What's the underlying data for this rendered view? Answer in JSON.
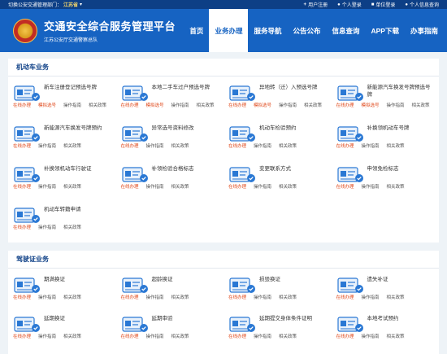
{
  "topbar": {
    "dept_label": "切换公安交通管理部门：",
    "dept_name": "江苏省",
    "register": "用户注册",
    "personal_login": "个人登录",
    "unit_login": "单位登录",
    "info_query": "个人信息查询"
  },
  "header": {
    "title": "交通安全综合服务管理平台",
    "subtitle": "江苏公安厅交通警察总队"
  },
  "nav": [
    "首页",
    "业务办理",
    "服务导航",
    "公告公布",
    "信息查询",
    "APP下载",
    "办事指南"
  ],
  "labels": {
    "online": "在线办理",
    "guide": "操作指南",
    "policy": "相关政策",
    "mock": "模拟选号"
  },
  "vehicle": {
    "title": "机动车业务",
    "items": [
      {
        "name": "新车注册登记预选号牌",
        "icon": "id-card-icon",
        "mock": true
      },
      {
        "name": "本地二手车过户预选号牌",
        "icon": "people-car-icon",
        "mock": true
      },
      {
        "name": "异地转（迁）入预选号牌",
        "icon": "transfer-car-icon",
        "mock": true
      },
      {
        "name": "新能源汽车换发号牌预选号牌",
        "icon": "ev-car-icon",
        "mock": true
      },
      {
        "name": "新能源汽车换发号牌预约",
        "icon": "ev-plate-icon",
        "mock": false
      },
      {
        "name": "异常选号资料修改",
        "icon": "plate-123-icon",
        "mock": false
      },
      {
        "name": "机动车检验预约",
        "icon": "inspection-icon",
        "mock": false
      },
      {
        "name": "补换领机动车号牌",
        "icon": "plate-replace-icon",
        "mock": false
      },
      {
        "name": "补换领机动车行驶证",
        "icon": "license-replace-icon",
        "mock": false
      },
      {
        "name": "补领检验合格标志",
        "icon": "inspection-badge-icon",
        "mock": false
      },
      {
        "name": "变更联系方式",
        "icon": "contact-card-icon",
        "mock": false
      },
      {
        "name": "申领免检标志",
        "icon": "exempt-badge-icon",
        "mock": false
      },
      {
        "name": "机动车转籍申请",
        "icon": "transfer-apply-icon",
        "mock": false
      }
    ]
  },
  "driver": {
    "title": "驾驶证业务",
    "items": [
      {
        "name": "期满换证",
        "icon": "renew-license-icon"
      },
      {
        "name": "超龄换证",
        "icon": "age-license-icon"
      },
      {
        "name": "损毁换证",
        "icon": "damaged-license-icon"
      },
      {
        "name": "遗失补证",
        "icon": "lost-license-icon"
      },
      {
        "name": "延期换证",
        "icon": "delay-license-icon"
      },
      {
        "name": "延期审验",
        "icon": "delay-review-icon"
      },
      {
        "name": "延期提交身体条件证明",
        "icon": "health-proof-icon"
      },
      {
        "name": "本地考试预约",
        "icon": "exam-booking-icon"
      }
    ]
  }
}
